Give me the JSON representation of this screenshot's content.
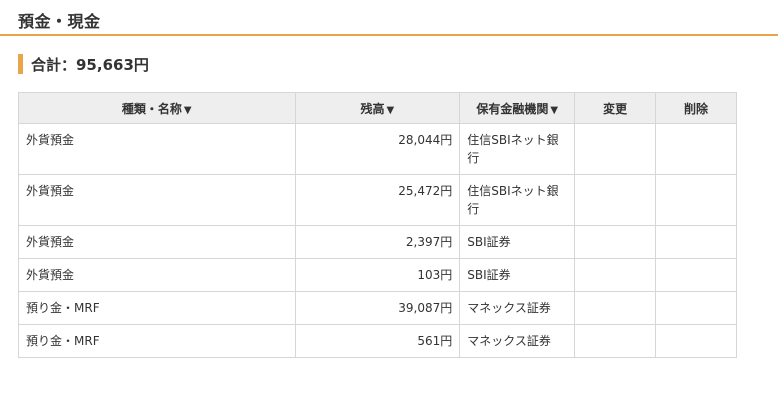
{
  "section": {
    "title": "預金・現金"
  },
  "total": {
    "text": "合計：95,663円"
  },
  "table": {
    "headers": {
      "name": "種類・名称",
      "balance": "残高",
      "institution": "保有金融機関",
      "change": "変更",
      "delete": "削除"
    },
    "sort_arrow": "▼",
    "rows": [
      {
        "name": "外貨預金",
        "balance": "28,044円",
        "institution": "住信SBIネット銀行"
      },
      {
        "name": "外貨預金",
        "balance": "25,472円",
        "institution": "住信SBIネット銀行"
      },
      {
        "name": "外貨預金",
        "balance": "2,397円",
        "institution": "SBI証券"
      },
      {
        "name": "外貨預金",
        "balance": "103円",
        "institution": "SBI証券"
      },
      {
        "name": "預り金・MRF",
        "balance": "39,087円",
        "institution": "マネックス証券"
      },
      {
        "name": "預り金・MRF",
        "balance": "561円",
        "institution": "マネックス証券"
      }
    ]
  },
  "colors": {
    "accent": "#e8a54a",
    "header_bg": "#eeeeee",
    "border": "#d6d6d6"
  }
}
